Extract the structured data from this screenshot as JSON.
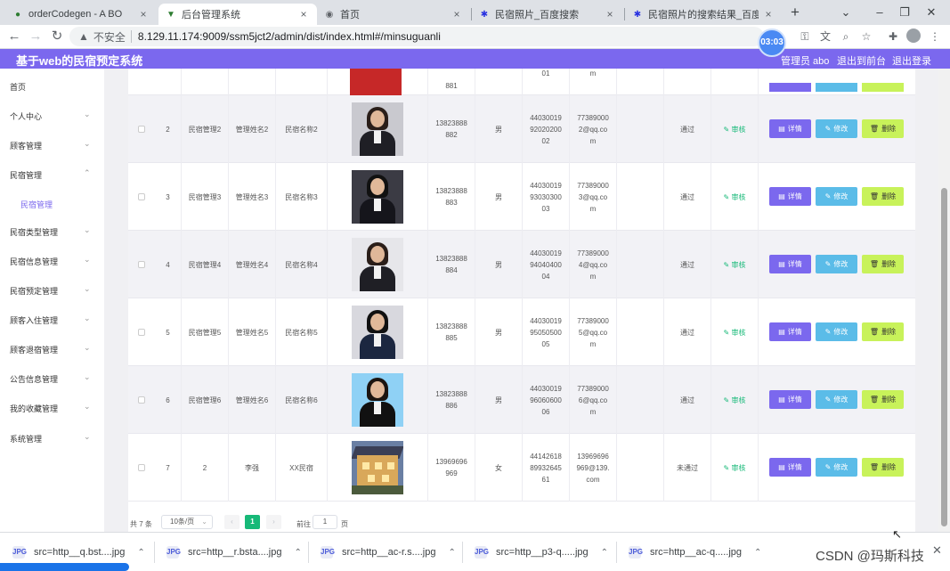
{
  "browser": {
    "tabs": [
      {
        "title": "orderCodegen - A BO",
        "icon": "leaf-icon"
      },
      {
        "title": "后台管理系统",
        "icon": "vue-logo-icon"
      },
      {
        "title": "首页",
        "icon": "globe-icon"
      },
      {
        "title": "民宿照片_百度搜索",
        "icon": "baidu-paw-icon"
      },
      {
        "title": "民宿照片的搜索结果_百度图片",
        "icon": "baidu-paw-icon"
      }
    ],
    "active_tab_index": 1,
    "security_label": "不安全",
    "url": "8.129.11.174:9009/ssm5jct2/admin/dist/index.html#/minsuguanli",
    "timer": "03:03"
  },
  "header": {
    "title": "基于web的民宿预定系统",
    "user_label": "管理员 abo",
    "front_label": "退出到前台",
    "logout_label": "退出登录",
    "accent_color": "#7b68ee"
  },
  "sidebar": {
    "items": [
      {
        "label": "首页",
        "chevron": ""
      },
      {
        "label": "个人中心",
        "chevron": "⌄"
      },
      {
        "label": "顾客管理",
        "chevron": "⌄"
      },
      {
        "label": "民宿管理",
        "chevron": "⌃"
      },
      {
        "label": "民宿管理",
        "chevron": ""
      },
      {
        "label": "民宿类型管理",
        "chevron": "⌄"
      },
      {
        "label": "民宿信息管理",
        "chevron": "⌄"
      },
      {
        "label": "民宿预定管理",
        "chevron": "⌄"
      },
      {
        "label": "顾客入住管理",
        "chevron": "⌄"
      },
      {
        "label": "顾客退宿管理",
        "chevron": "⌄"
      },
      {
        "label": "公告信息管理",
        "chevron": "⌄"
      },
      {
        "label": "我的收藏管理",
        "chevron": "⌄"
      },
      {
        "label": "系统管理",
        "chevron": "⌄"
      }
    ]
  },
  "table": {
    "partial_row": {
      "phone_tail": "881",
      "id_tail": "01",
      "email_tail": "m"
    },
    "rows": [
      {
        "index": "2",
        "username": "民宿管理2",
        "manager": "管理姓名2",
        "name": "民宿名称2",
        "phone": "13823888 882",
        "gender": "男",
        "idcard": "44030019 92020200 02",
        "email": "77389000 2@qq.co m",
        "status": "通过",
        "photo": "woman-dark"
      },
      {
        "index": "3",
        "username": "民宿管理3",
        "manager": "管理姓名3",
        "name": "民宿名称3",
        "phone": "13823888 883",
        "gender": "男",
        "idcard": "44030019 93030300 03",
        "email": "77389000 3@qq.co m",
        "status": "通过",
        "photo": "man-dark"
      },
      {
        "index": "4",
        "username": "民宿管理4",
        "manager": "管理姓名4",
        "name": "民宿名称4",
        "phone": "13823888 884",
        "gender": "男",
        "idcard": "44030019 94040400 04",
        "email": "77389000 4@qq.co m",
        "status": "通过",
        "photo": "woman-light"
      },
      {
        "index": "5",
        "username": "民宿管理5",
        "manager": "管理姓名5",
        "name": "民宿名称5",
        "phone": "13823888 885",
        "gender": "男",
        "idcard": "44030019 95050500 05",
        "email": "77389000 5@qq.co m",
        "status": "通过",
        "photo": "man-light"
      },
      {
        "index": "6",
        "username": "民宿管理6",
        "manager": "管理姓名6",
        "name": "民宿名称6",
        "phone": "13823888 886",
        "gender": "男",
        "idcard": "44030019 96060600 06",
        "email": "77389000 6@qq.co m",
        "status": "通过",
        "photo": "woman-blue"
      },
      {
        "index": "7",
        "username": "2",
        "manager": "李强",
        "name": "XX民宿",
        "phone": "13969696 969",
        "gender": "女",
        "idcard": "44142618 89932645 61",
        "email": "13969696 969@139. com",
        "status": "未通过",
        "photo": "house"
      }
    ],
    "actions": {
      "audit": "审核",
      "detail": "详情",
      "edit": "修改",
      "delete": "删除"
    }
  },
  "pager": {
    "total": "共 7 条",
    "page_size": "10条/页",
    "current": "1",
    "goto": "前往",
    "goto_value": "1",
    "page_unit": "页"
  },
  "downloads": [
    {
      "name": "src=http__q.bst....jpg"
    },
    {
      "name": "src=http__r.bsta....jpg"
    },
    {
      "name": "src=http__ac-r.s....jpg"
    },
    {
      "name": "src=http__p3-q.....jpg"
    },
    {
      "name": "src=http__ac-q.....jpg"
    }
  ],
  "watermark": "CSDN @玛斯科技"
}
